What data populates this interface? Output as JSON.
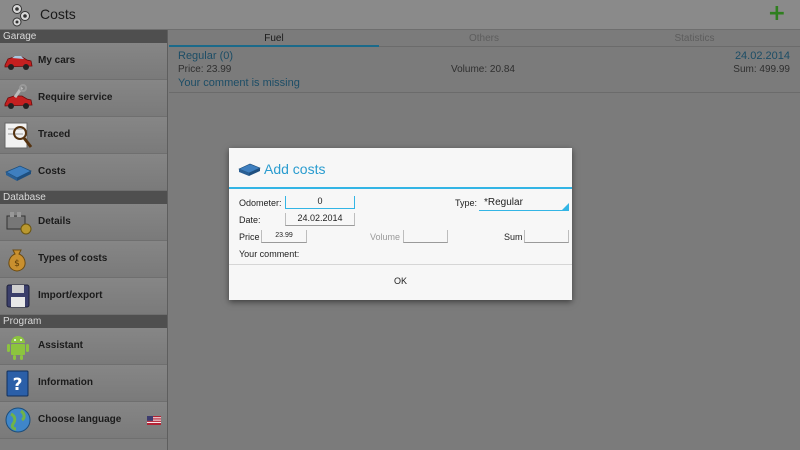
{
  "actionbar": {
    "title": "Costs"
  },
  "sidebar": {
    "sections": [
      {
        "header": "Garage",
        "items": [
          {
            "label": "My cars"
          },
          {
            "label": "Require service"
          },
          {
            "label": "Traced"
          },
          {
            "label": "Costs"
          }
        ]
      },
      {
        "header": "Database",
        "items": [
          {
            "label": "Details"
          },
          {
            "label": "Types of costs"
          },
          {
            "label": "Import/export"
          }
        ]
      },
      {
        "header": "Program",
        "items": [
          {
            "label": "Assistant"
          },
          {
            "label": "Information"
          },
          {
            "label": "Choose language"
          }
        ]
      }
    ]
  },
  "tabs": [
    {
      "label": "Fuel",
      "active": true
    },
    {
      "label": "Others",
      "active": false
    },
    {
      "label": "Statistics",
      "active": false
    }
  ],
  "record": {
    "name": "Regular (0)",
    "date": "24.02.2014",
    "price": "Price: 23.99",
    "volume": "Volume: 20.84",
    "sum": "Sum: 499.99",
    "comment": "Your comment is missing"
  },
  "dialog": {
    "title": "Add costs",
    "odometer_label": "Odometer:",
    "odometer_value": "0",
    "type_label": "Type:",
    "type_value": "*Regular",
    "date_label": "Date:",
    "date_value": "24.02.2014",
    "price_label": "Price",
    "price_value": "23.99",
    "volume_label": "Volume",
    "volume_value": "",
    "sum_label": "Sum",
    "sum_value": "",
    "comment_label": "Your comment:",
    "ok_label": "OK"
  },
  "colors": {
    "accent": "#33b5e5",
    "dialog_title": "#2a9ccf",
    "link_text": "#1c4d66",
    "add_icon": "#2f7f1f"
  }
}
